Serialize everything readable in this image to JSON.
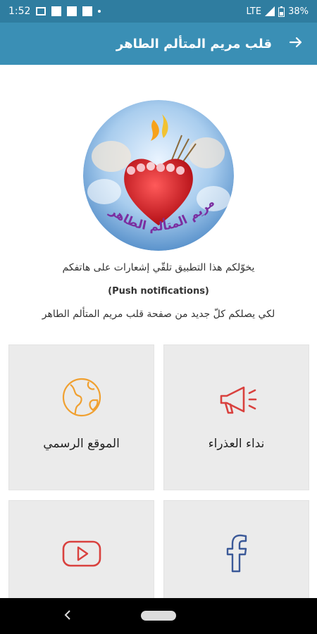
{
  "status": {
    "time": "1:52",
    "network": "LTE",
    "battery": "38%"
  },
  "header": {
    "title": "قلب مريم المتألم الطاهر",
    "back_icon": "arrow-right-icon"
  },
  "logo": {
    "caption": "قلب مريم المتألم الطاهر"
  },
  "notice": {
    "line1": "يخوّلكم هذا التطبيق تلقّي إشعارات على هاتفكم",
    "line2": "(Push notifications)",
    "line3": "لكي يصلكم كلّ جديد من صفحة قلب مريم المتألم الطاهر"
  },
  "tiles": [
    {
      "label": "نداء العذراء",
      "icon": "megaphone-icon"
    },
    {
      "label": "الموقع الرسمي",
      "icon": "globe-icon"
    },
    {
      "label": "",
      "icon": "facebook-icon"
    },
    {
      "label": "",
      "icon": "youtube-icon"
    }
  ],
  "colors": {
    "status_bar": "#2f7da0",
    "app_bar": "#3a8fb5",
    "icon_red": "#d9413e",
    "icon_orange": "#f0a030",
    "facebook_blue": "#3b5998"
  }
}
